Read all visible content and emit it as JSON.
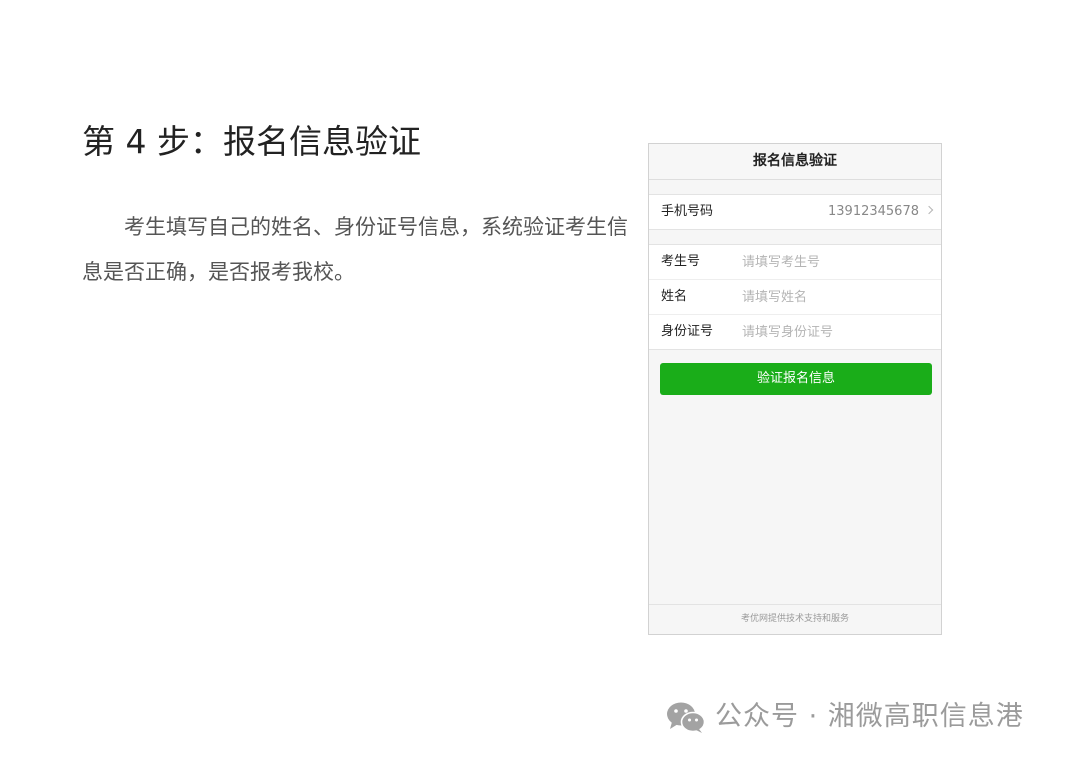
{
  "step": {
    "title": "第 4 步：报名信息验证",
    "description": "考生填写自己的姓名、身份证号信息，系统验证考生信息是否正确，是否报考我校。"
  },
  "phone": {
    "header_title": "报名信息验证",
    "phone_row": {
      "label": "手机号码",
      "value": "13912345678"
    },
    "form": {
      "exam_number": {
        "label": "考生号",
        "placeholder": "请填写考生号"
      },
      "name": {
        "label": "姓名",
        "placeholder": "请填写姓名"
      },
      "id_number": {
        "label": "身份证号",
        "placeholder": "请填写身份证号"
      }
    },
    "verify_button_label": "验证报名信息",
    "footer_text": "考优网提供技术支持和服务",
    "accent_color": "#1aad19"
  },
  "watermark": {
    "icon": "wechat-icon",
    "text": "公众号 · 湘微高职信息港"
  }
}
